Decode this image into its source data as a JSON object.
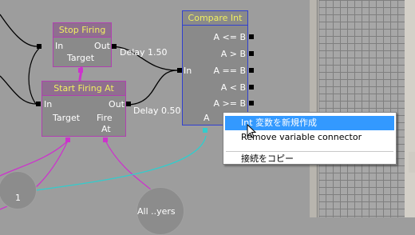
{
  "nodes": {
    "stop_firing": {
      "title": "Stop Firing",
      "in_label": "In",
      "out_label": "Out",
      "target_label": "Target"
    },
    "start_firing": {
      "title": "Start Firing At",
      "in_label": "In",
      "out_label": "Out",
      "target_label": "Target",
      "fire_label_1": "Fire",
      "fire_label_2": "At"
    },
    "compare_int": {
      "title": "Compare Int",
      "in_label": "In",
      "a_label": "A",
      "outputs": [
        "A <= B",
        "A > B",
        "A == B",
        "A < B",
        "A >= B"
      ]
    }
  },
  "delays": {
    "stop_firing": "Delay 1.50",
    "start_firing": "Delay 0.50"
  },
  "variables": {
    "int_var": "1",
    "object_list": "All ..yers"
  },
  "context_menu": {
    "items": [
      {
        "label": "Int 変数を新規作成",
        "highlighted": true
      },
      {
        "label": "Remove variable connector",
        "highlighted": false
      },
      {
        "label": "接続をコピー",
        "highlighted": false
      }
    ]
  },
  "colors": {
    "canvas_bg": "#9d9d9d",
    "action_node_border": "#b040b0",
    "action_title_bg": "#8f6f8f",
    "action_title_text": "#f0f060",
    "condition_node_border": "#3040d0",
    "condition_title_text": "#f0f060",
    "var_link_magenta": "#cc33cc",
    "var_link_cyan": "#33cccc",
    "wire_black": "#000000",
    "menu_highlight": "#3399ff"
  }
}
